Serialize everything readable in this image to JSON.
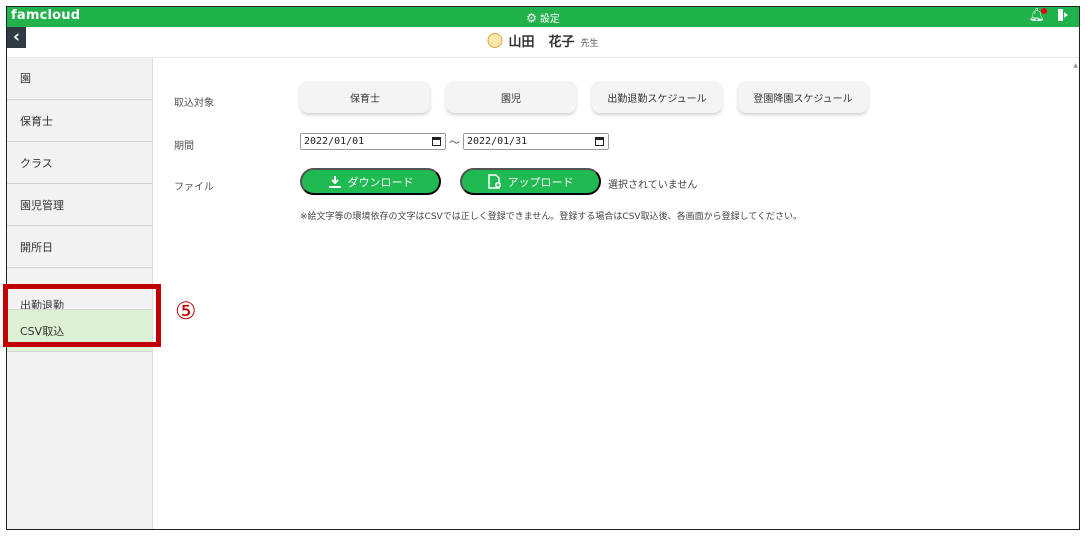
{
  "app": {
    "brand": "famcloud",
    "settings_label": "設定"
  },
  "user": {
    "last_name": "山田",
    "first_name": "花子",
    "honorific": "先生"
  },
  "sidebar": {
    "items": [
      {
        "label": "園"
      },
      {
        "label": "保育士"
      },
      {
        "label": "クラス"
      },
      {
        "label": "園児管理"
      },
      {
        "label": "開所日"
      },
      {
        "label": "出勤退勤"
      },
      {
        "label": "CSV取込"
      }
    ],
    "active": "CSV取込"
  },
  "annotation": {
    "marker": "⑤",
    "color": "#c00000"
  },
  "form": {
    "target_label": "取込対象",
    "targets": [
      "保育士",
      "園児",
      "出勤退勤スケジュール",
      "登園降園スケジュール"
    ],
    "period_label": "期間",
    "date_from": "2022/01/01",
    "date_separator": "～",
    "date_to": "2022/01/31",
    "file_label": "ファイル",
    "download_label": "ダウンロード",
    "upload_label": "アップロード",
    "no_file_text": "選択されていません",
    "note": "※絵文字等の環境依存の文字はCSVでは正しく登録できません。登録する場合はCSV取込後、各画面から登録してください。"
  },
  "colors": {
    "brand_green": "#22b24c",
    "button_green": "#1fba52",
    "active_bg": "#dcf0d4",
    "sidebar_bg": "#f2f2f2"
  }
}
